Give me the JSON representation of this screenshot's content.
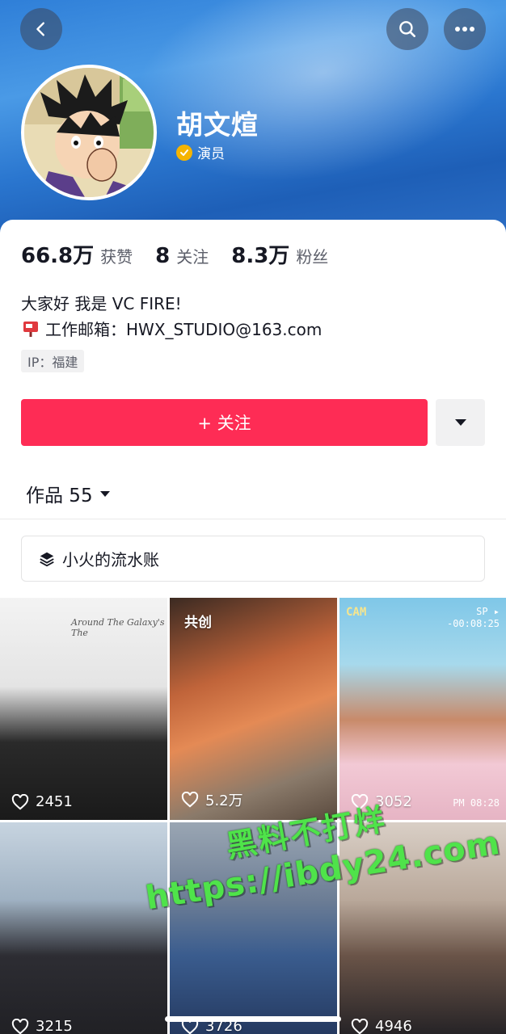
{
  "header": {
    "profile_name": "胡文煊",
    "verified_label": "演员"
  },
  "stats": [
    {
      "value": "66.8万",
      "label": "获赞"
    },
    {
      "value": "8",
      "label": "关注"
    },
    {
      "value": "8.3万",
      "label": "粉丝"
    }
  ],
  "bio": {
    "line1": "大家好 我是 VC FIRE!",
    "line2": "工作邮箱：HWX_STUDIO@163.com",
    "ip": "IP：福建"
  },
  "actions": {
    "follow_label": "+ 关注"
  },
  "tabs": {
    "works_label": "作品 55"
  },
  "collection": {
    "label": "小火的流水账"
  },
  "videos": [
    {
      "likes": "2451",
      "overlay": "Around The Galaxy's The"
    },
    {
      "likes": "5.2万",
      "tag": "共创"
    },
    {
      "likes": "3052",
      "cam": "CAM",
      "sp": "SP ▸",
      "time": "-00:08:25",
      "pm": "PM 08:28"
    },
    {
      "likes": "3215"
    },
    {
      "likes": "3726"
    },
    {
      "likes": "4946"
    }
  ],
  "watermark": {
    "line1": "黑料不打烊",
    "line2": "https://ibdy24.com"
  },
  "colors": {
    "accent": "#fe2c55",
    "banner": "#2f7fd8",
    "verified_badge": "#f5b400"
  }
}
